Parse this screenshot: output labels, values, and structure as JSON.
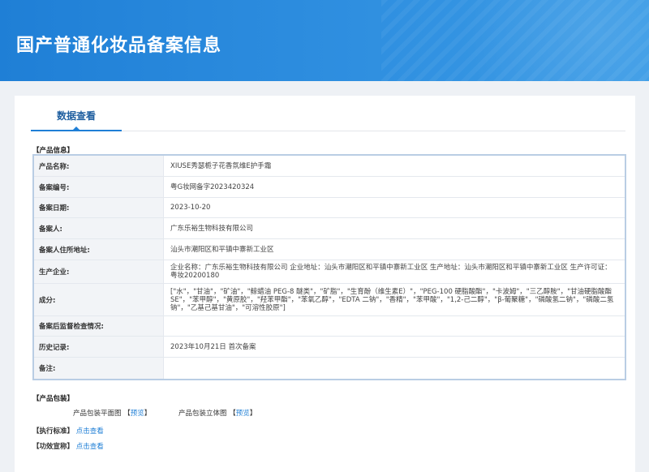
{
  "header": {
    "title": "国产普通化妆品备案信息"
  },
  "tab": {
    "label": "数据查看"
  },
  "product_info": {
    "section_title": "【产品信息】",
    "rows": [
      {
        "label": "产品名称:",
        "value": "XIUSE秀瑟栀子花香氛维E护手霜"
      },
      {
        "label": "备案编号:",
        "value": "粤G妆网备字2023420324"
      },
      {
        "label": "备案日期:",
        "value": "2023-10-20"
      },
      {
        "label": "备案人:",
        "value": "广东乐裕生物科技有限公司"
      },
      {
        "label": "备案人住所地址:",
        "value": "汕头市潮阳区和平镇中寨新工业区"
      },
      {
        "label": "生产企业:",
        "value": "企业名称：广东乐裕生物科技有限公司 企业地址：汕头市潮阳区和平镇中寨新工业区 生产地址：汕头市潮阳区和平镇中寨新工业区 生产许可证：粤妆20200180"
      },
      {
        "label": "成分:",
        "value": "[\"水\"，\"甘油\"，\"矿油\"，\"鲸蜡油 PEG-8 醚类\"，\"矿脂\"，\"生育酚（维生素E）\"，\"PEG-100 硬脂酸酯\"，\"卡波姆\"，\"三乙醇胺\"，\"甘油硬脂酸酯 SE\"，\"苯甲醇\"，\"黄原胶\"，\"羟苯甲酯\"，\"苯氧乙醇\"，\"EDTA 二钠\"，\"香精\"，\"苯甲酸\"，\"1,2-己二醇\"，\"β-葡聚糖\"，\"磷酸氢二钠\"，\"磷酸二氢钠\"，\"乙基己基甘油\"，\"可溶性胶原\"]"
      },
      {
        "label": "备案后监督检查情况:",
        "value": ""
      },
      {
        "label": "历史记录:",
        "value": "2023年10月21日 首次备案"
      },
      {
        "label": "备注:",
        "value": ""
      }
    ]
  },
  "packaging": {
    "section_title": "【产品包装】",
    "flat_label": "产品包装平面图",
    "flat_link": "预览",
    "solid_label": "产品包装立体图",
    "solid_link": "预览",
    "bracket_open": "【",
    "bracket_close": "】"
  },
  "standard": {
    "label": "【执行标准】",
    "link": "点击查看"
  },
  "efficacy": {
    "label": "【功效宣称】",
    "link": "点击查看"
  }
}
